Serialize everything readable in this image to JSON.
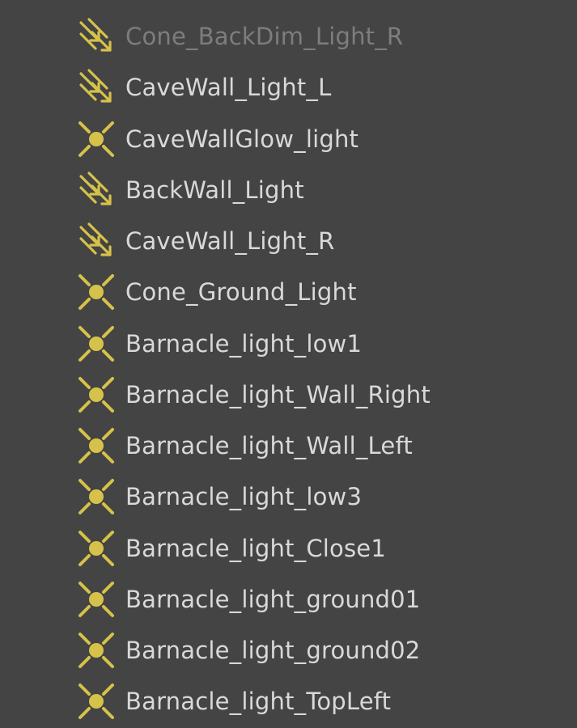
{
  "outliner": {
    "items": [
      {
        "label": "Cone_BackDim_Light_R",
        "icon": "directional-light-icon",
        "dimmed": true
      },
      {
        "label": "CaveWall_Light_L",
        "icon": "directional-light-icon",
        "dimmed": false
      },
      {
        "label": "CaveWallGlow_light",
        "icon": "point-light-icon",
        "dimmed": false
      },
      {
        "label": "BackWall_Light",
        "icon": "directional-light-icon",
        "dimmed": false
      },
      {
        "label": "CaveWall_Light_R",
        "icon": "directional-light-icon",
        "dimmed": false
      },
      {
        "label": "Cone_Ground_Light",
        "icon": "point-light-icon",
        "dimmed": false
      },
      {
        "label": "Barnacle_light_low1",
        "icon": "point-light-icon",
        "dimmed": false
      },
      {
        "label": "Barnacle_light_Wall_Right",
        "icon": "point-light-icon",
        "dimmed": false
      },
      {
        "label": "Barnacle_light_Wall_Left",
        "icon": "point-light-icon",
        "dimmed": false
      },
      {
        "label": "Barnacle_light_low3",
        "icon": "point-light-icon",
        "dimmed": false
      },
      {
        "label": "Barnacle_light_Close1",
        "icon": "point-light-icon",
        "dimmed": false
      },
      {
        "label": "Barnacle_light_ground01",
        "icon": "point-light-icon",
        "dimmed": false
      },
      {
        "label": "Barnacle_light_ground02",
        "icon": "point-light-icon",
        "dimmed": false
      },
      {
        "label": "Barnacle_light_TopLeft",
        "icon": "point-light-icon",
        "dimmed": false
      }
    ]
  },
  "colors": {
    "background": "#444444",
    "icon": "#d6c24a",
    "text": "#d9d9d9",
    "text_dimmed": "#7d7d7d"
  }
}
